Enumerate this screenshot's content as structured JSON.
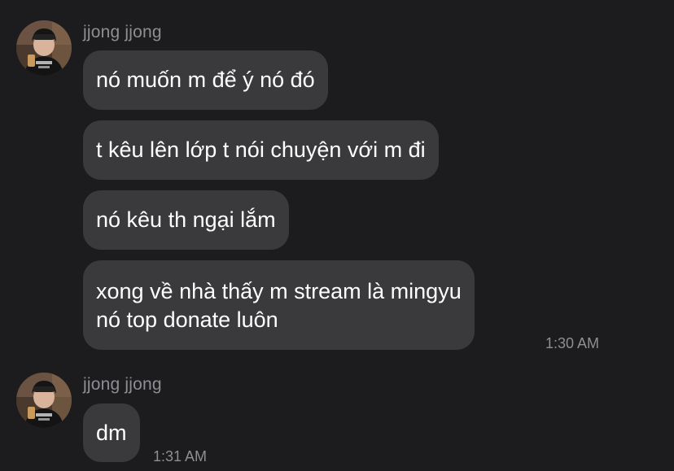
{
  "conversation": {
    "groups": [
      {
        "sender": "jjong jjong",
        "messages": [
          {
            "lines": [
              "nó muốn m để ý nó đó"
            ]
          },
          {
            "lines": [
              "t kêu lên lớp t nói chuyện với m đi"
            ]
          },
          {
            "lines": [
              "nó kêu th ngại lắm"
            ]
          },
          {
            "lines": [
              "xong về nhà thấy m stream là mingyu",
              "nó top donate luôn"
            ],
            "time": "1:30 AM"
          }
        ]
      },
      {
        "sender": "jjong jjong",
        "messages": [
          {
            "lines": [
              "dm"
            ],
            "time": "1:31 AM"
          }
        ]
      }
    ]
  },
  "colors": {
    "background": "#1c1c1e",
    "bubble": "#3a3a3c",
    "secondary_text": "#8e8e93",
    "primary_text": "#ffffff"
  },
  "icons": {
    "avatar": "profile-photo-avatar"
  }
}
